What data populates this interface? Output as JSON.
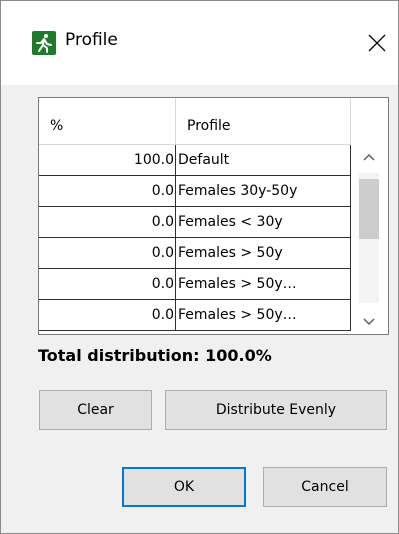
{
  "window": {
    "title": "Profile"
  },
  "table": {
    "headers": {
      "percent": "%",
      "profile": "Profile"
    },
    "rows": [
      {
        "percent": "100.0",
        "profile": "Default"
      },
      {
        "percent": "0.0",
        "profile": "Females 30y-50y"
      },
      {
        "percent": "0.0",
        "profile": "Females < 30y"
      },
      {
        "percent": "0.0",
        "profile": "Females > 50y"
      },
      {
        "percent": "0.0",
        "profile": "Females > 50y…"
      },
      {
        "percent": "0.0",
        "profile": "Females > 50y…"
      }
    ]
  },
  "summary": {
    "total_label": "Total distribution: 100.0%"
  },
  "buttons": {
    "clear": "Clear",
    "distribute": "Distribute Evenly",
    "ok": "OK",
    "cancel": "Cancel"
  },
  "icons": {
    "app": "running-person-icon",
    "close": "close-icon",
    "scroll_up": "chevron-up-icon",
    "scroll_down": "chevron-down-icon"
  },
  "colors": {
    "app_icon_bg": "#1f7a2e",
    "focus_border": "#0078d7",
    "dialog_bg": "#f0f0f0"
  }
}
